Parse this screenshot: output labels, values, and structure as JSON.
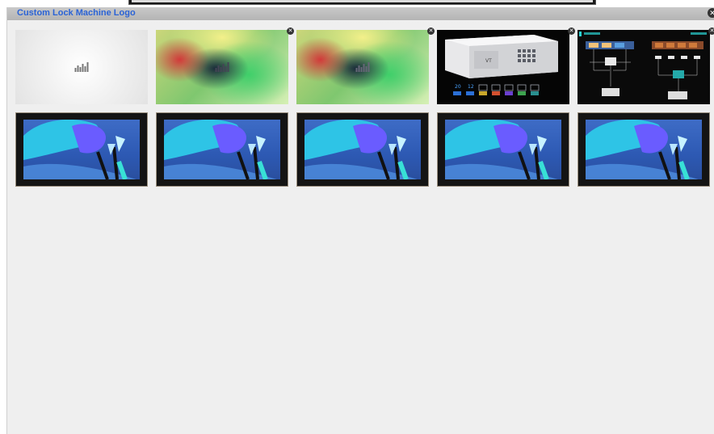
{
  "panel": {
    "title": "Custom Lock Machine Logo",
    "close_icon": "close-icon",
    "accent_color": "#2a63d6"
  },
  "thumbnails": {
    "row1": [
      {
        "name": "blank-logo-image",
        "has_delete": false
      },
      {
        "name": "gradient-logo-image-1",
        "has_delete": true
      },
      {
        "name": "gradient-logo-image-2",
        "has_delete": true
      },
      {
        "name": "machine-product-image",
        "has_delete": true,
        "labels": [
          "20",
          "12"
        ]
      },
      {
        "name": "system-diagram-image",
        "has_delete": true
      }
    ],
    "row2": [
      {
        "name": "brush-screen-image-1"
      },
      {
        "name": "brush-screen-image-2"
      },
      {
        "name": "brush-screen-image-3"
      },
      {
        "name": "brush-screen-image-4"
      },
      {
        "name": "brush-screen-image-5"
      }
    ]
  },
  "machine": {
    "brand": "VT",
    "label_a": "20",
    "label_b": "12"
  }
}
